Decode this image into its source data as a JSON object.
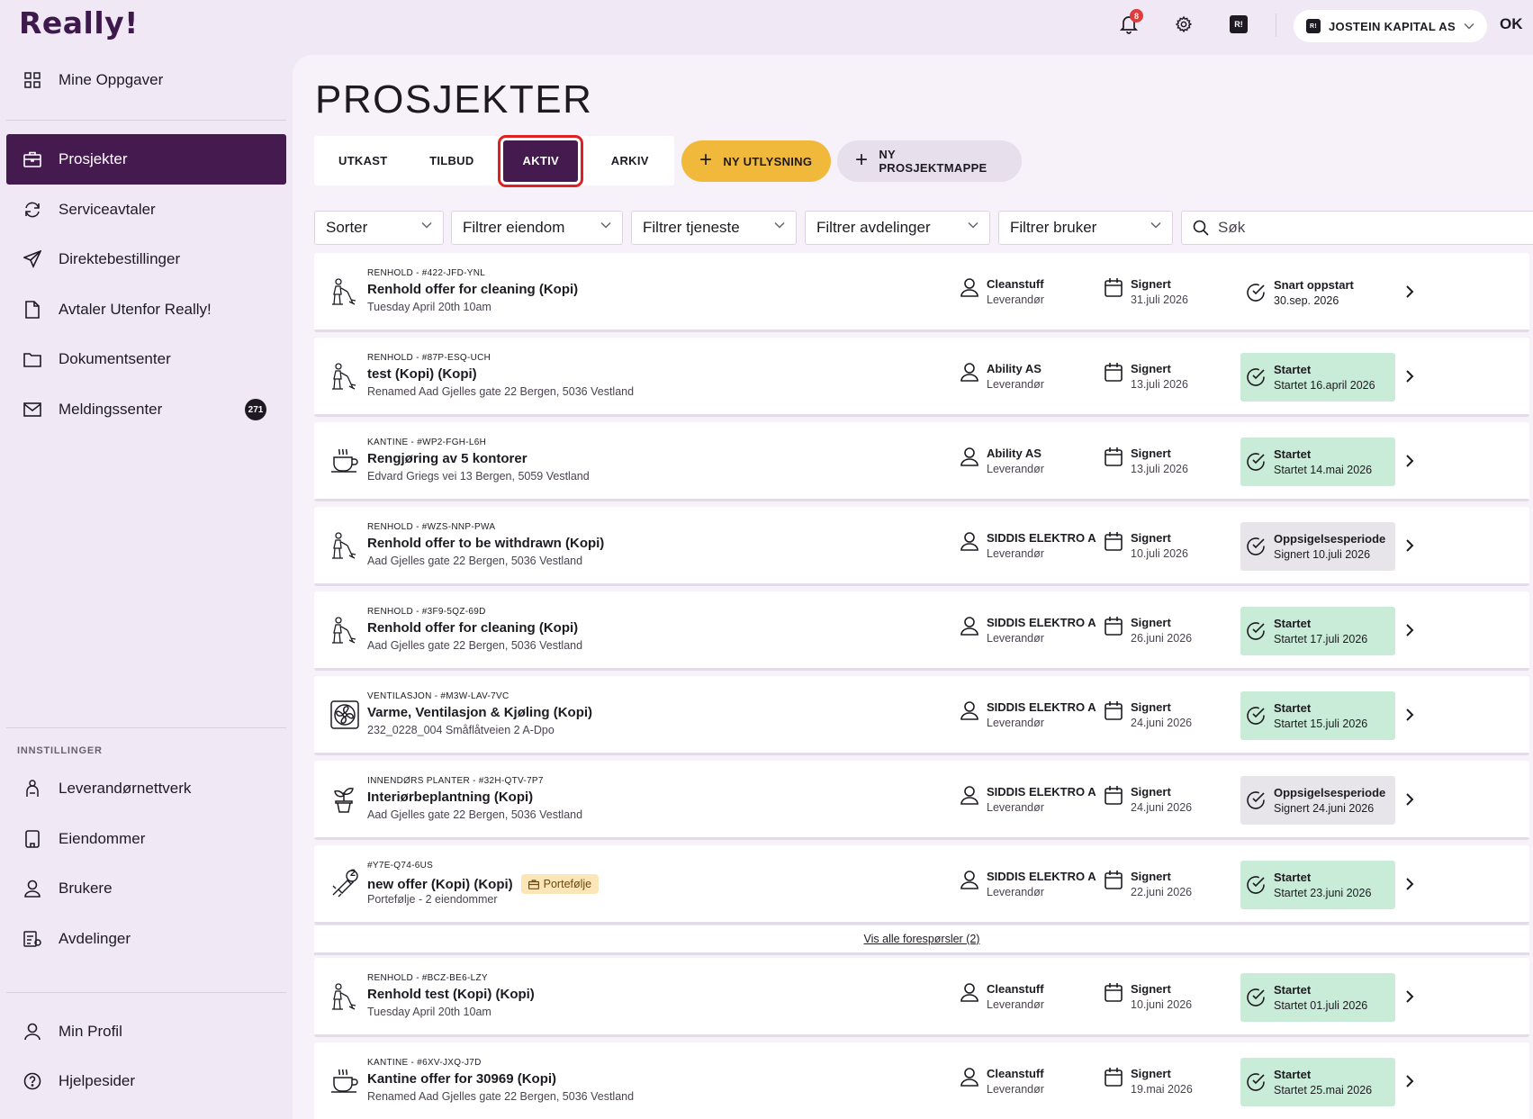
{
  "app": {
    "logo": "Really!"
  },
  "topbar": {
    "notification_count": "8",
    "r_badge": "R!",
    "company": "JOSTEIN KAPITAL AS",
    "user_initials": "OK"
  },
  "sidebar": {
    "items_top": [
      {
        "label": "Mine Oppgaver",
        "icon": "grid-icon"
      }
    ],
    "items_main": [
      {
        "label": "Prosjekter",
        "icon": "briefcase-icon",
        "active": true
      },
      {
        "label": "Serviceavtaler",
        "icon": "refresh-icon"
      },
      {
        "label": "Direktebestillinger",
        "icon": "send-icon"
      },
      {
        "label": "Avtaler Utenfor Really!",
        "icon": "file-icon"
      },
      {
        "label": "Dokumentsenter",
        "icon": "folder-icon"
      },
      {
        "label": "Meldingssenter",
        "icon": "mail-icon",
        "badge": "271"
      }
    ],
    "settings_heading": "INNSTILLINGER",
    "items_settings": [
      {
        "label": "Leverandørnettverk",
        "icon": "network-icon"
      },
      {
        "label": "Eiendommer",
        "icon": "building-icon"
      },
      {
        "label": "Brukere",
        "icon": "user-icon"
      },
      {
        "label": "Avdelinger",
        "icon": "departments-icon"
      }
    ],
    "items_bottom": [
      {
        "label": "Min Profil",
        "icon": "profile-icon"
      },
      {
        "label": "Hjelpesider",
        "icon": "help-icon"
      }
    ]
  },
  "main": {
    "title": "PROSJEKTER",
    "tabs": [
      "UTKAST",
      "TILBUD",
      "AKTIV",
      "ARKIV"
    ],
    "active_tab": "AKTIV",
    "btn_new_tender": "NY UTLYSNING",
    "btn_new_folder": "NY PROSJEKTMAPPE",
    "filters": [
      "Sorter",
      "Filtrer eiendom",
      "Filtrer tjeneste",
      "Filtrer avdelinger",
      "Filtrer bruker"
    ],
    "search_placeholder": "Søk",
    "view_all": "Vis alle forespørsler (2)"
  },
  "rows": [
    {
      "meta": "RENHOLD - #422-JFD-YNL",
      "title": "Renhold offer for cleaning (Kopi)",
      "sub": "Tuesday April 20th 10am",
      "icon": "cleaning-icon",
      "supplier": "Cleanstuff",
      "supplier_role": "Leverandør",
      "signed_label": "Signert",
      "signed_date": "31.juli 2026",
      "status": "Snart oppstart",
      "status_sub": "30.sep. 2026",
      "status_style": "plain"
    },
    {
      "meta": "RENHOLD - #87P-ESQ-UCH",
      "title": "test (Kopi) (Kopi)",
      "sub": "Renamed Aad Gjelles gate 22 Bergen, 5036 Vestland",
      "icon": "cleaning-icon",
      "supplier": "Ability AS",
      "supplier_role": "Leverandør",
      "signed_label": "Signert",
      "signed_date": "13.juli 2026",
      "status": "Startet",
      "status_sub": "Startet 16.april 2026",
      "status_style": "green"
    },
    {
      "meta": "KANTINE - #WP2-FGH-L6H",
      "title": "Rengjøring av 5 kontorer",
      "sub": "Edvard Griegs vei 13 Bergen, 5059 Vestland",
      "icon": "coffee-icon",
      "supplier": "Ability AS",
      "supplier_role": "Leverandør",
      "signed_label": "Signert",
      "signed_date": "13.juli 2026",
      "status": "Startet",
      "status_sub": "Startet 14.mai 2026",
      "status_style": "green"
    },
    {
      "meta": "RENHOLD - #WZS-NNP-PWA",
      "title": "Renhold offer to be withdrawn (Kopi)",
      "sub": "Aad Gjelles gate 22 Bergen, 5036 Vestland",
      "icon": "cleaning-icon",
      "supplier": "SIDDIS ELEKTRO A",
      "supplier_role": "Leverandør",
      "signed_label": "Signert",
      "signed_date": "10.juli 2026",
      "status": "Oppsigelsesperiode",
      "status_sub": "Signert 10.juli 2026",
      "status_style": "grey"
    },
    {
      "meta": "RENHOLD - #3F9-5QZ-69D",
      "title": "Renhold offer for cleaning (Kopi)",
      "sub": "Aad Gjelles gate 22 Bergen, 5036 Vestland",
      "icon": "cleaning-icon",
      "supplier": "SIDDIS ELEKTRO A",
      "supplier_role": "Leverandør",
      "signed_label": "Signert",
      "signed_date": "26.juni 2026",
      "status": "Startet",
      "status_sub": "Startet 17.juli 2026",
      "status_style": "green"
    },
    {
      "meta": "VENTILASJON - #M3W-LAV-7VC",
      "title": "Varme, Ventilasjon & Kjøling (Kopi)",
      "sub": "232_0228_004 Småflåtveien 2 A-Dpo",
      "icon": "fan-icon",
      "supplier": "SIDDIS ELEKTRO A",
      "supplier_role": "Leverandør",
      "signed_label": "Signert",
      "signed_date": "24.juni 2026",
      "status": "Startet",
      "status_sub": "Startet 15.juli 2026",
      "status_style": "green"
    },
    {
      "meta": "INNENDØRS PLANTER - #32H-QTV-7P7",
      "title": "Interiørbeplantning (Kopi)",
      "sub": "Aad Gjelles gate 22 Bergen, 5036 Vestland",
      "icon": "plant-icon",
      "supplier": "SIDDIS ELEKTRO A",
      "supplier_role": "Leverandør",
      "signed_label": "Signert",
      "signed_date": "24.juni 2026",
      "status": "Oppsigelsesperiode",
      "status_sub": "Signert 24.juni 2026",
      "status_style": "grey"
    },
    {
      "meta": "#Y7E-Q74-6US",
      "title": "new offer (Kopi) (Kopi)",
      "badge": "Portefølje",
      "sub": "Portefølje - 2 eiendommer",
      "icon": "multi-service-icon",
      "icon_count": "2",
      "supplier": "SIDDIS ELEKTRO A",
      "supplier_role": "Leverandør",
      "signed_label": "Signert",
      "signed_date": "22.juni 2026",
      "status": "Startet",
      "status_sub": "Startet 23.juni 2026",
      "status_style": "green"
    },
    {
      "meta": "RENHOLD - #BCZ-BE6-LZY",
      "title": "Renhold test (Kopi) (Kopi)",
      "sub": "Tuesday April 20th 10am",
      "icon": "cleaning-icon",
      "supplier": "Cleanstuff",
      "supplier_role": "Leverandør",
      "signed_label": "Signert",
      "signed_date": "10.juni 2026",
      "status": "Startet",
      "status_sub": "Startet 01.juli 2026",
      "status_style": "green"
    },
    {
      "meta": "KANTINE - #6XV-JXQ-J7D",
      "title": "Kantine offer for 30969 (Kopi)",
      "sub": "Renamed Aad Gjelles gate 22 Bergen, 5036 Vestland",
      "icon": "coffee-icon",
      "supplier": "Cleanstuff",
      "supplier_role": "Leverandør",
      "signed_label": "Signert",
      "signed_date": "19.mai 2026",
      "status": "Startet",
      "status_sub": "Startet 25.mai 2026",
      "status_style": "green"
    }
  ]
}
